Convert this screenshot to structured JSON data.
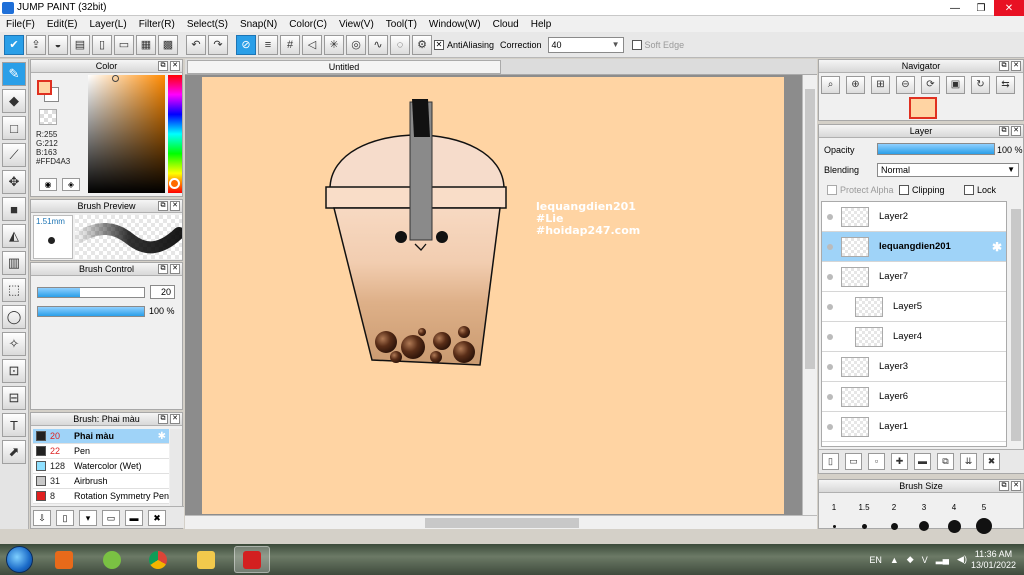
{
  "window": {
    "title": "JUMP PAINT (32bit)",
    "minimize": "—",
    "maximize": "❐",
    "close": "✕"
  },
  "menu": [
    "File(F)",
    "Edit(E)",
    "Layer(L)",
    "Filter(R)",
    "Select(S)",
    "Snap(N)",
    "Color(C)",
    "View(V)",
    "Tool(T)",
    "Window(W)",
    "Cloud",
    "Help"
  ],
  "toolbar": {
    "antialiasing": "AntiAliasing",
    "correction_label": "Correction",
    "correction_value": "40",
    "soft_edge": "Soft Edge"
  },
  "color_panel": {
    "title": "Color",
    "r": "R:255",
    "g": "G:212",
    "b": "B:163",
    "hex": "#FFD4A3",
    "fg": "#FFD4A3"
  },
  "brush_preview": {
    "title": "Brush Preview",
    "size": "1.51mm"
  },
  "brush_control": {
    "title": "Brush Control",
    "size_value": "20",
    "size_fraction": 0.4,
    "opacity_value": "100 %",
    "opacity_fraction": 1.0
  },
  "brush_list": {
    "title": "Brush: Phai màu",
    "items": [
      {
        "num": "20",
        "name": "Phai màu",
        "color": "#222222",
        "selected": true
      },
      {
        "num": "22",
        "name": "Pen",
        "color": "#222222",
        "selected": false
      },
      {
        "num": "128",
        "name": "Watercolor (Wet)",
        "color": "#8fe0ff",
        "selected": false
      },
      {
        "num": "31",
        "name": "Airbrush",
        "color": "#c8c8c8",
        "selected": false
      },
      {
        "num": "8",
        "name": "Rotation Symmetry Pen",
        "color": "#e02020",
        "selected": false
      }
    ]
  },
  "canvas": {
    "tab": "Untitled",
    "watermark": [
      "lequangdien201",
      "#Lie",
      "#hoidap247.com"
    ],
    "bg": "#FFD4A3"
  },
  "navigator": {
    "title": "Navigator"
  },
  "layer_panel": {
    "title": "Layer",
    "opacity_label": "Opacity",
    "opacity_value": "100 %",
    "blending_label": "Blending",
    "blending_value": "Normal",
    "protect_alpha": "Protect Alpha",
    "clipping": "Clipping",
    "lock": "Lock",
    "layers": [
      {
        "name": "Layer2",
        "selected": false,
        "sub": false
      },
      {
        "name": "lequangdien201",
        "selected": true,
        "sub": false
      },
      {
        "name": "Layer7",
        "selected": false,
        "sub": false
      },
      {
        "name": "Layer5",
        "selected": false,
        "sub": true
      },
      {
        "name": "Layer4",
        "selected": false,
        "sub": true
      },
      {
        "name": "Layer3",
        "selected": false,
        "sub": false
      },
      {
        "name": "Layer6",
        "selected": false,
        "sub": false
      },
      {
        "name": "Layer1",
        "selected": false,
        "sub": false
      }
    ]
  },
  "brush_size": {
    "title": "Brush Size",
    "sizes": [
      "1",
      "1.5",
      "2",
      "3",
      "4",
      "5"
    ]
  },
  "taskbar": {
    "lang": "EN",
    "time": "11:36 AM",
    "date": "13/01/2022"
  }
}
